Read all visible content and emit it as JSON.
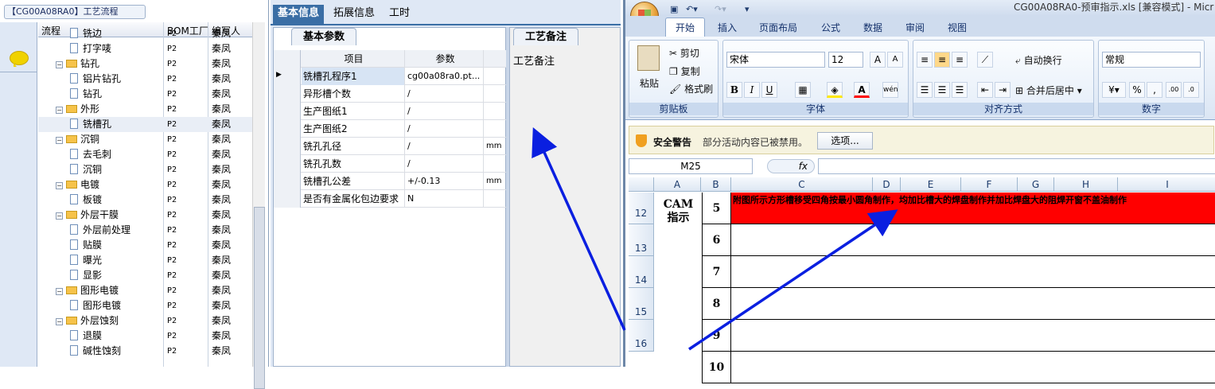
{
  "left_panel": {
    "title": "【CG00A08RA0】工艺流程",
    "columns": [
      "流程",
      "BOM工厂",
      "编写人"
    ],
    "rows": [
      {
        "label": "铣边",
        "type": "doc",
        "indent": 2,
        "factory": "P2",
        "author": "秦凤"
      },
      {
        "label": "打字唛",
        "type": "doc",
        "indent": 2,
        "factory": "P2",
        "author": "秦凤"
      },
      {
        "label": "钻孔",
        "type": "folder",
        "indent": 1,
        "factory": "P2",
        "author": "秦凤"
      },
      {
        "label": "铝片钻孔",
        "type": "doc",
        "indent": 2,
        "factory": "P2",
        "author": "秦凤"
      },
      {
        "label": "钻孔",
        "type": "doc",
        "indent": 2,
        "factory": "P2",
        "author": "秦凤"
      },
      {
        "label": "外形",
        "type": "folder",
        "indent": 1,
        "factory": "P2",
        "author": "秦凤"
      },
      {
        "label": "铣槽孔",
        "type": "doc",
        "indent": 2,
        "factory": "P2",
        "author": "秦凤",
        "selected": true
      },
      {
        "label": "沉铜",
        "type": "folder",
        "indent": 1,
        "factory": "P2",
        "author": "秦凤"
      },
      {
        "label": "去毛刺",
        "type": "doc",
        "indent": 2,
        "factory": "P2",
        "author": "秦凤"
      },
      {
        "label": "沉铜",
        "type": "doc",
        "indent": 2,
        "factory": "P2",
        "author": "秦凤"
      },
      {
        "label": "电镀",
        "type": "folder",
        "indent": 1,
        "factory": "P2",
        "author": "秦凤"
      },
      {
        "label": "板镀",
        "type": "doc",
        "indent": 2,
        "factory": "P2",
        "author": "秦凤"
      },
      {
        "label": "外层干膜",
        "type": "folder",
        "indent": 1,
        "factory": "P2",
        "author": "秦凤"
      },
      {
        "label": "外层前处理",
        "type": "doc",
        "indent": 2,
        "factory": "P2",
        "author": "秦凤"
      },
      {
        "label": "贴膜",
        "type": "doc",
        "indent": 2,
        "factory": "P2",
        "author": "秦凤"
      },
      {
        "label": "曝光",
        "type": "doc",
        "indent": 2,
        "factory": "P2",
        "author": "秦凤"
      },
      {
        "label": "显影",
        "type": "doc",
        "indent": 2,
        "factory": "P2",
        "author": "秦凤"
      },
      {
        "label": "图形电镀",
        "type": "folder",
        "indent": 1,
        "factory": "P2",
        "author": "秦凤"
      },
      {
        "label": "图形电镀",
        "type": "doc",
        "indent": 2,
        "factory": "P2",
        "author": "秦凤"
      },
      {
        "label": "外层蚀刻",
        "type": "folder",
        "indent": 1,
        "factory": "P2",
        "author": "秦凤"
      },
      {
        "label": "退膜",
        "type": "doc",
        "indent": 2,
        "factory": "P2",
        "author": "秦凤"
      },
      {
        "label": "碱性蚀刻",
        "type": "doc",
        "indent": 2,
        "factory": "P2",
        "author": "秦凤"
      }
    ]
  },
  "mid_panel": {
    "tabs": [
      "基本信息",
      "拓展信息",
      "工时"
    ],
    "params_tab": "基本参数",
    "remarks_tab": "工艺备注",
    "remarks_label": "工艺备注",
    "grid_headers": [
      "项目",
      "参数"
    ],
    "params": [
      {
        "name": "铣槽孔程序1",
        "value": "cg00a08ra0.pt...",
        "unit": "",
        "current": true
      },
      {
        "name": "异形槽个数",
        "value": "/",
        "unit": ""
      },
      {
        "name": "生产图纸1",
        "value": "/",
        "unit": ""
      },
      {
        "name": "生产图纸2",
        "value": "/",
        "unit": ""
      },
      {
        "name": "铣孔孔径",
        "value": "/",
        "unit": "mm"
      },
      {
        "name": "铣孔孔数",
        "value": "/",
        "unit": ""
      },
      {
        "name": "铣槽孔公差",
        "value": "+/-0.13",
        "unit": "mm"
      },
      {
        "name": "是否有金属化包边要求",
        "value": "N",
        "unit": ""
      }
    ]
  },
  "excel": {
    "window_title": "CG00A08RA0-预审指示.xls [兼容模式] - Micr",
    "ribbon_tabs": [
      "开始",
      "插入",
      "页面布局",
      "公式",
      "数据",
      "审阅",
      "视图"
    ],
    "clipboard": {
      "paste": "粘贴",
      "cut": "剪切",
      "copy": "复制",
      "format_painter": "格式刷",
      "label": "剪贴板"
    },
    "font": {
      "name": "宋体",
      "size": "12",
      "label": "字体"
    },
    "alignment": {
      "wrap": "自动换行",
      "merge": "合并后居中",
      "label": "对齐方式"
    },
    "number": {
      "format": "常规",
      "label": "数字"
    },
    "security": {
      "title": "安全警告",
      "message": "部分活动内容已被禁用。",
      "button": "选项..."
    },
    "name_box": "M25",
    "fx": "fx",
    "columns": [
      "A",
      "B",
      "C",
      "D",
      "E",
      "F",
      "G",
      "H",
      "I"
    ],
    "row_numbers": [
      "12",
      "13",
      "14",
      "15",
      "16"
    ],
    "cam_label": "CAM\n指示",
    "b_values": [
      "5",
      "6",
      "7",
      "8",
      "9",
      "10"
    ],
    "instruction": "附图所示方形槽移受四角按最小圆角制作，均加比槽大的焊盘制作并加比焊盘大的阻焊开窗不盖油制作",
    "colors": {
      "instruction_bg": "#ff0000",
      "arrow": "#0a1fe0",
      "tab_active": "#3a6ea5"
    }
  }
}
